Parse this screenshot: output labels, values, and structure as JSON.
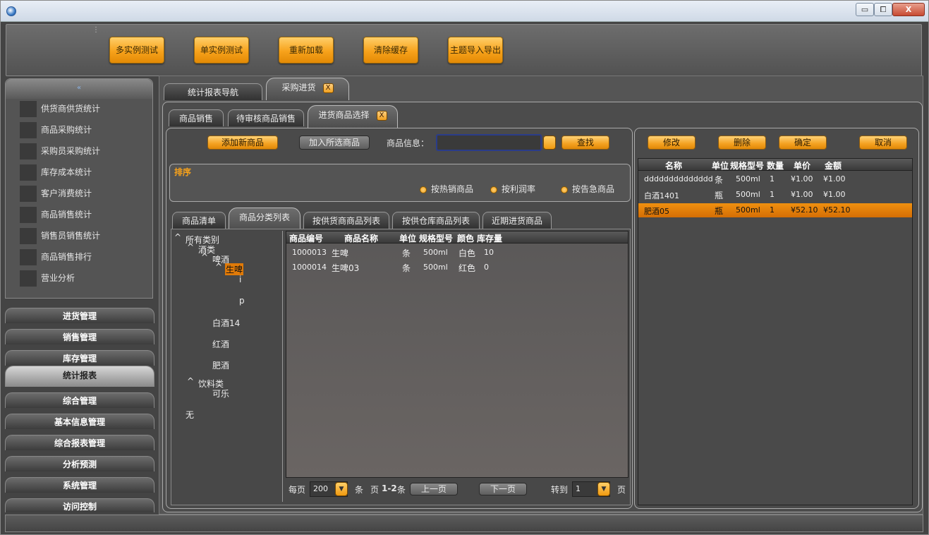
{
  "window": {
    "min_label": "▭",
    "max_label": "⧠",
    "close_label": "X"
  },
  "toolbar": {
    "grip": "⋮",
    "buttons": [
      "多实例测试",
      "单实例测试",
      "重新加载",
      "清除缓存",
      "主题导入导出"
    ]
  },
  "sidebar": {
    "collapse_label": "«",
    "items": [
      "供货商供货统计",
      "商品采购统计",
      "采购员采购统计",
      "库存成本统计",
      "客户消费统计",
      "商品销售统计",
      "销售员销售统计",
      "商品销售排行",
      "营业分析"
    ],
    "nav": [
      "进货管理",
      "销售管理",
      "库存管理",
      "统计报表",
      "综合管理",
      "基本信息管理",
      "综合报表管理",
      "分析预测",
      "系统管理",
      "访问控制"
    ]
  },
  "main_tabs": [
    {
      "label": "统计报表导航"
    },
    {
      "label": "采购进货"
    }
  ],
  "sub_tabs": [
    {
      "label": "商品销售"
    },
    {
      "label": "待审核商品销售"
    },
    {
      "label": "进货商品选择"
    }
  ],
  "close_label": "X",
  "actions": {
    "add": "添加新商品",
    "join": "加入所选商品",
    "info_label": "商品信息：",
    "info_value": "",
    "search": "查找"
  },
  "sort": {
    "title": "排序",
    "options": [
      "按热销商品",
      "按利润率",
      "按告急商品"
    ]
  },
  "list_tabs": [
    "商品清单",
    "商品分类列表",
    "按供货商商品列表",
    "按供仓库商品列表",
    "近期进货商品"
  ],
  "tree": {
    "root": "所有类别",
    "n_alcohol": "酒类",
    "n_beer": "啤酒",
    "n_draft": "生啤",
    "n_i": "i",
    "n_p": "p",
    "n_white": "白酒14",
    "n_red": "红酒",
    "n_fei": "肥酒",
    "n_drinks": "饮料类",
    "n_cola": "可乐",
    "n_none": "无",
    "arrow": "^"
  },
  "goods_table": {
    "headers": [
      "商品编号",
      "商品名称",
      "单位",
      "规格型号",
      "颜色",
      "库存量"
    ],
    "rows": [
      [
        "1000013",
        "生啤",
        "条",
        "500ml",
        "白色",
        "10"
      ],
      [
        "1000014",
        "生啤03",
        "条",
        "500ml",
        "红色",
        "0"
      ]
    ]
  },
  "pager": {
    "per_page": "每页",
    "per_page_value": "200",
    "unit": "条",
    "page": "页",
    "range": "1-2",
    "unit2": "条",
    "prev": "上一页",
    "next": "下一页",
    "goto": "转到",
    "goto_value": "1",
    "page_suffix": "页"
  },
  "right_actions": [
    "修改",
    "删除",
    "确定",
    "取消"
  ],
  "order_table": {
    "headers": [
      "名称",
      "单位",
      "规格型号",
      "数量",
      "单价",
      "金额"
    ],
    "rows": [
      [
        "dddddddddddddd",
        "条",
        "500ml",
        "1",
        "¥1.00",
        "¥1.00"
      ],
      [
        "白酒1401",
        "瓶",
        "500ml",
        "1",
        "¥1.00",
        "¥1.00"
      ],
      [
        "肥酒05",
        "瓶",
        "500ml",
        "1",
        "¥52.10",
        "¥52.10"
      ]
    ],
    "selected_row": 2
  },
  "colors": {
    "accent": "#f7a21b",
    "selected_row": "#e07a08",
    "panel": "#4a4a4a"
  }
}
